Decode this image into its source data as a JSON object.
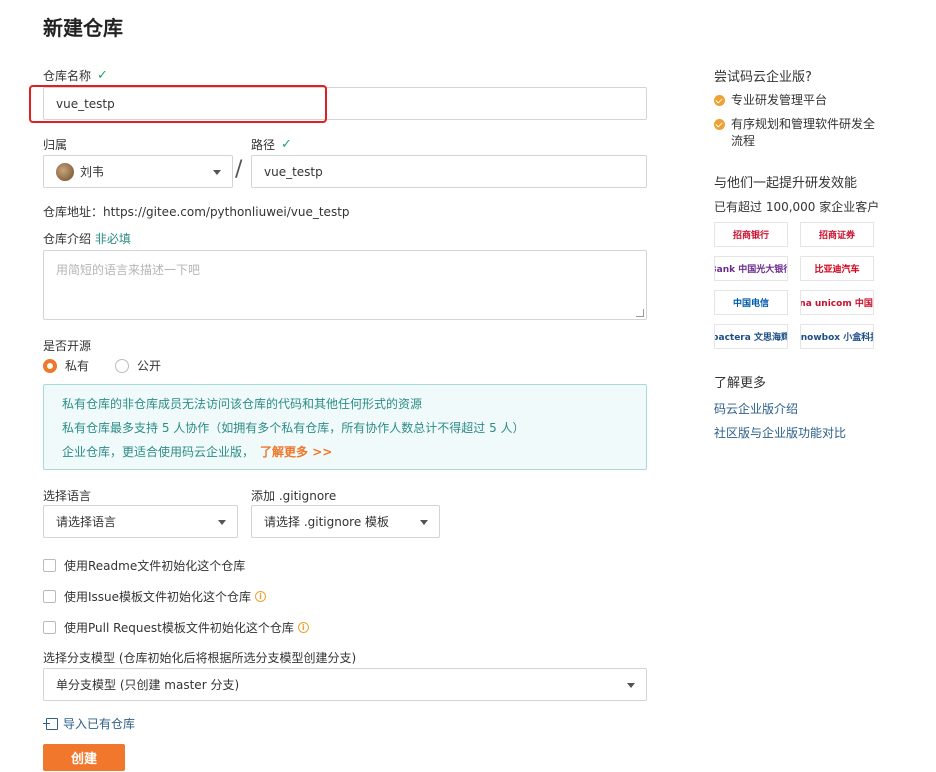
{
  "page": {
    "title": "新建仓库"
  },
  "form": {
    "repo_name_label": "仓库名称",
    "repo_name_value": "vue_testp",
    "owner_label": "归属",
    "owner_value": "刘韦",
    "path_label": "路径",
    "path_separator": "/",
    "path_value": "vue_testp",
    "repo_url_label": "仓库地址：",
    "repo_url_value": "https://gitee.com/pythonliuwei/vue_testp",
    "desc_label": "仓库介绍",
    "desc_optional": "非必填",
    "desc_placeholder": "用简短的语言来描述一下吧",
    "open_source_label": "是否开源",
    "visibility_private": "私有",
    "visibility_public": "公开",
    "info_lines": [
      "私有仓库的非仓库成员无法访问该仓库的代码和其他任何形式的资源",
      "私有仓库最多支持 5 人协作（如拥有多个私有仓库，所有协作人数总计不得超过 5 人）",
      "企业仓库，更适合使用码云企业版，"
    ],
    "info_link": "了解更多 >>",
    "language_label": "选择语言",
    "language_value": "请选择语言",
    "gitignore_label": "添加 .gitignore",
    "gitignore_value": "请选择 .gitignore 模板",
    "checkbox_readme": "使用Readme文件初始化这个仓库",
    "checkbox_issue": "使用Issue模板文件初始化这个仓库",
    "checkbox_pr": "使用Pull Request模板文件初始化这个仓库",
    "branch_label": "选择分支模型 (仓库初始化后将根据所选分支模型创建分支)",
    "branch_value": "单分支模型 (只创建 master 分支)",
    "import_link": "导入已有仓库",
    "create_button": "创建"
  },
  "sidebar": {
    "try_title": "尝试码云企业版?",
    "features": [
      "专业研发管理平台",
      "有序规划和管理软件研发全流程"
    ],
    "together_title": "与他们一起提升研发效能",
    "customers_text": "已有超过 100,000 家企业客户",
    "logos": [
      {
        "name": "招商银行",
        "color": "#c8102e"
      },
      {
        "name": "招商证券",
        "color": "#c8102e"
      },
      {
        "name": "Bank 中国光大银行",
        "color": "#6b2c91"
      },
      {
        "name": "比亚迪汽车",
        "color": "#d0021b"
      },
      {
        "name": "中国电信",
        "color": "#005bac"
      },
      {
        "name": "China unicom 中国联通",
        "color": "#c8102e"
      },
      {
        "name": "pactera 文思海辉",
        "color": "#1d4e89"
      },
      {
        "name": "knowbox 小盒科技",
        "color": "#1d4e89"
      }
    ],
    "learn_title": "了解更多",
    "links": [
      "码云企业版介绍",
      "社区版与企业版功能对比"
    ]
  },
  "colors": {
    "accent": "#f0772b",
    "success": "#21a366",
    "link": "#2b5f8a",
    "highlight": "#e02020"
  }
}
